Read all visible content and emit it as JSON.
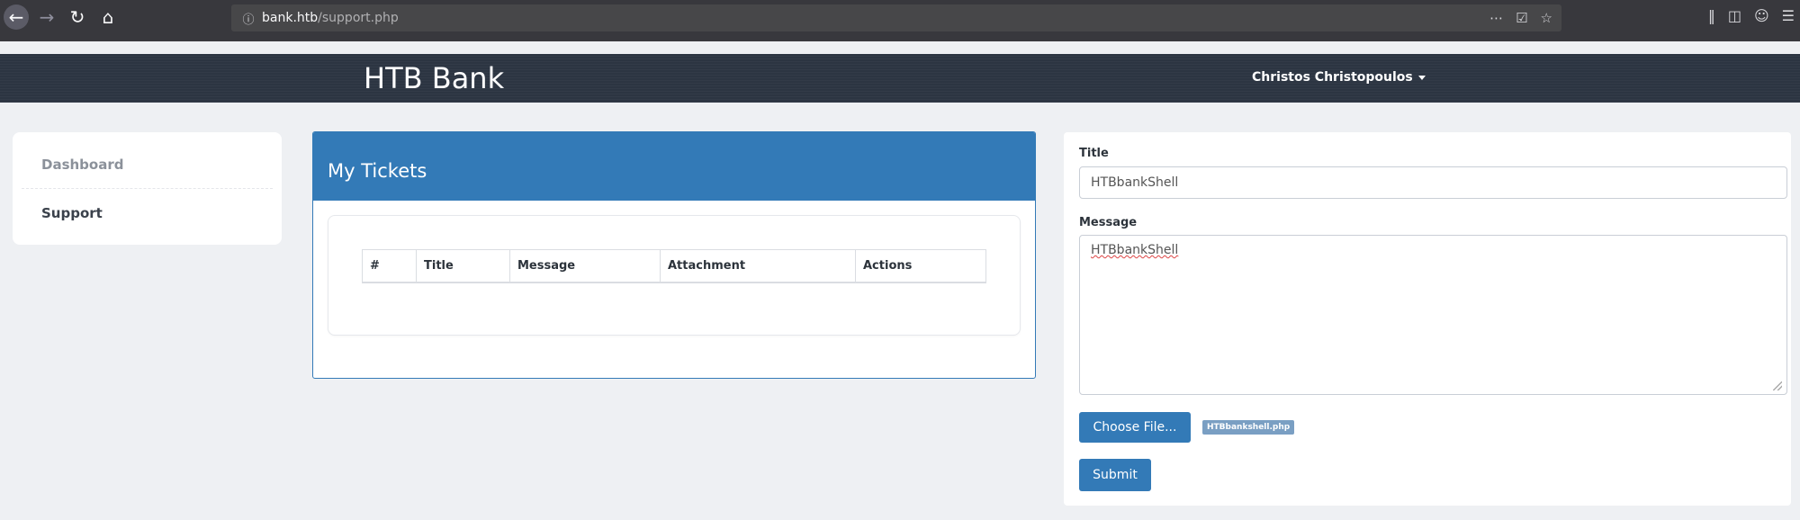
{
  "browser": {
    "url_host": "bank.htb",
    "url_path": "/support.php",
    "icons": [
      "back-icon",
      "forward-icon",
      "reload-icon",
      "home-icon",
      "info-icon",
      "more-icon",
      "pocket-icon",
      "bookmark-star-icon",
      "library-icon",
      "sidebar-icon",
      "account-icon",
      "hamburger-menu-icon"
    ]
  },
  "navbar": {
    "brand": "HTB Bank",
    "user": "Christos Christopoulos"
  },
  "sidebar": {
    "items": [
      {
        "label": "Dashboard"
      },
      {
        "label": "Support"
      }
    ]
  },
  "tickets": {
    "title": "My Tickets",
    "columns": [
      "#",
      "Title",
      "Message",
      "Attachment",
      "Actions"
    ]
  },
  "form": {
    "title_label": "Title",
    "title_value": "HTBbankShell",
    "message_label": "Message",
    "message_value": "HTBbankShell",
    "choose_file_label": "Choose File...",
    "file_name": "HTBbankshell.php",
    "submit_label": "Submit"
  },
  "colors": {
    "primary": "#337ab7",
    "navbar": "#2c3542",
    "background": "#eef0f3"
  }
}
